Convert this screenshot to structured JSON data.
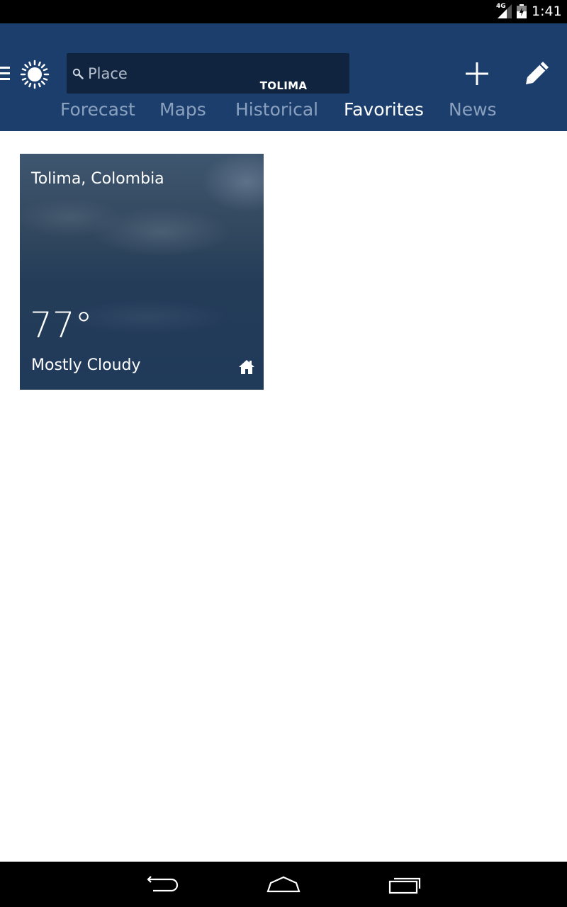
{
  "status_bar": {
    "network": "4G",
    "time": "1:41"
  },
  "header": {
    "search": {
      "placeholder": "Place",
      "value": ""
    },
    "location": "TOLIMA",
    "tabs": [
      {
        "label": "Forecast",
        "active": false
      },
      {
        "label": "Maps",
        "active": false
      },
      {
        "label": "Historical",
        "active": false
      },
      {
        "label": "Favorites",
        "active": true
      },
      {
        "label": "News",
        "active": false
      }
    ],
    "icons": [
      "menu-icon",
      "sun-icon",
      "search-icon",
      "add-icon",
      "edit-icon"
    ]
  },
  "favorites": [
    {
      "city": "Tolima, Colombia",
      "temperature": "77°",
      "condition": "Mostly Cloudy",
      "is_home": true
    }
  ],
  "nav_bar": {
    "icons": [
      "back-icon",
      "home-icon",
      "recents-icon"
    ]
  },
  "colors": {
    "header_bg": "#1b3e6d",
    "search_bg": "#11243f",
    "tab_inactive": "#8aa0bd",
    "tab_active": "#ffffff",
    "card_bg": "#203a5a"
  }
}
